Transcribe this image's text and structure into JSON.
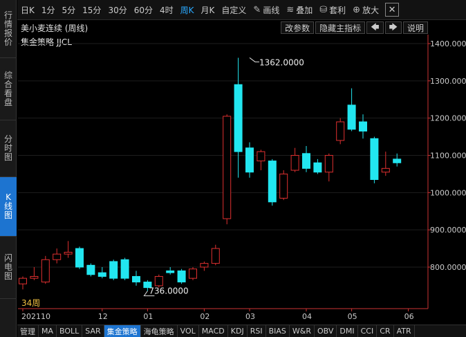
{
  "leftnav": [
    {
      "label": "行情报价",
      "active": false
    },
    {
      "label": "综合看盘",
      "active": false
    },
    {
      "label": "分时图",
      "active": false
    },
    {
      "label": "K线图",
      "active": true
    },
    {
      "label": "闪电图",
      "active": false
    }
  ],
  "toolbar": {
    "periods": [
      "日K",
      "1分",
      "5分",
      "15分",
      "30分",
      "60分",
      "4时",
      "周K",
      "月K",
      "自定义"
    ],
    "active_period": "周K",
    "draw_label": "画线",
    "overlay_label": "叠加",
    "arb_label": "套利",
    "zoom_label": "放大",
    "close_label": "✕"
  },
  "titlebar": {
    "title": "美小麦连续 (周线)",
    "params_button": "改参数",
    "hide_indicator_button": "隐藏主指标",
    "left_arrow": "🡄",
    "right_arrow": "🡆",
    "help_button": "说明"
  },
  "strategy_label": "集金策略 JJCL",
  "period_count_label": "34周",
  "chart_data": {
    "type": "candlestick",
    "ylim": [
      700,
      1420
    ],
    "yticks": [
      "1400.0000",
      "1300.0000",
      "1200.0000",
      "1100.0000",
      "1000.0000",
      "900.0000",
      "800.0000"
    ],
    "ytick_values": [
      1400,
      1300,
      1200,
      1100,
      1000,
      900,
      800
    ],
    "xticks": [
      {
        "label": "202110",
        "index": 0
      },
      {
        "label": "12",
        "index": 7
      },
      {
        "label": "01",
        "index": 11
      },
      {
        "label": "02",
        "index": 16
      },
      {
        "label": "03",
        "index": 20
      },
      {
        "label": "04",
        "index": 25
      },
      {
        "label": "05",
        "index": 29
      },
      {
        "label": "06",
        "index": 34
      }
    ],
    "annotations": [
      {
        "text": "1362.0000",
        "value": 1362,
        "index": 20
      },
      {
        "text": "736.0000",
        "value": 736,
        "index": 11
      }
    ],
    "candles": [
      {
        "o": 755,
        "h": 775,
        "l": 740,
        "c": 770
      },
      {
        "o": 770,
        "h": 800,
        "l": 765,
        "c": 775
      },
      {
        "o": 760,
        "h": 830,
        "l": 755,
        "c": 820
      },
      {
        "o": 820,
        "h": 850,
        "l": 810,
        "c": 835
      },
      {
        "o": 835,
        "h": 870,
        "l": 825,
        "c": 840
      },
      {
        "o": 850,
        "h": 855,
        "l": 795,
        "c": 800
      },
      {
        "o": 805,
        "h": 810,
        "l": 775,
        "c": 780
      },
      {
        "o": 785,
        "h": 800,
        "l": 770,
        "c": 775
      },
      {
        "o": 815,
        "h": 820,
        "l": 765,
        "c": 770
      },
      {
        "o": 820,
        "h": 825,
        "l": 765,
        "c": 770
      },
      {
        "o": 775,
        "h": 790,
        "l": 750,
        "c": 760
      },
      {
        "o": 760,
        "h": 765,
        "l": 736,
        "c": 745
      },
      {
        "o": 750,
        "h": 780,
        "l": 745,
        "c": 775
      },
      {
        "o": 790,
        "h": 800,
        "l": 780,
        "c": 785
      },
      {
        "o": 790,
        "h": 795,
        "l": 755,
        "c": 760
      },
      {
        "o": 770,
        "h": 800,
        "l": 765,
        "c": 795
      },
      {
        "o": 800,
        "h": 815,
        "l": 790,
        "c": 810
      },
      {
        "o": 810,
        "h": 860,
        "l": 805,
        "c": 850
      },
      {
        "o": 930,
        "h": 1210,
        "l": 915,
        "c": 1205
      },
      {
        "o": 1290,
        "h": 1362,
        "l": 1040,
        "c": 1110
      },
      {
        "o": 1120,
        "h": 1135,
        "l": 1040,
        "c": 1055
      },
      {
        "o": 1085,
        "h": 1115,
        "l": 1060,
        "c": 1110
      },
      {
        "o": 1085,
        "h": 1090,
        "l": 965,
        "c": 975
      },
      {
        "o": 985,
        "h": 1060,
        "l": 980,
        "c": 1050
      },
      {
        "o": 1060,
        "h": 1120,
        "l": 1055,
        "c": 1100
      },
      {
        "o": 1105,
        "h": 1125,
        "l": 1055,
        "c": 1065
      },
      {
        "o": 1080,
        "h": 1090,
        "l": 1050,
        "c": 1055
      },
      {
        "o": 1055,
        "h": 1105,
        "l": 1030,
        "c": 1100
      },
      {
        "o": 1140,
        "h": 1200,
        "l": 1130,
        "c": 1190
      },
      {
        "o": 1235,
        "h": 1280,
        "l": 1165,
        "c": 1170
      },
      {
        "o": 1190,
        "h": 1210,
        "l": 1145,
        "c": 1165
      },
      {
        "o": 1145,
        "h": 1150,
        "l": 1025,
        "c": 1035
      },
      {
        "o": 1055,
        "h": 1110,
        "l": 1045,
        "c": 1065
      },
      {
        "o": 1090,
        "h": 1105,
        "l": 1070,
        "c": 1080
      }
    ]
  },
  "indicator_tabs": [
    "管理",
    "MA",
    "BOLL",
    "SAR",
    "集金策略",
    "海龟策略",
    "VOL",
    "MACD",
    "KDJ",
    "RSI",
    "BIAS",
    "W&R",
    "OBV",
    "DMI",
    "CCI",
    "CR",
    "ATR"
  ],
  "active_indicator": "集金策略",
  "colors": {
    "up": "#e03030",
    "down": "#22e6f0",
    "accent": "#1d74d0",
    "axis": "#cc3333"
  }
}
